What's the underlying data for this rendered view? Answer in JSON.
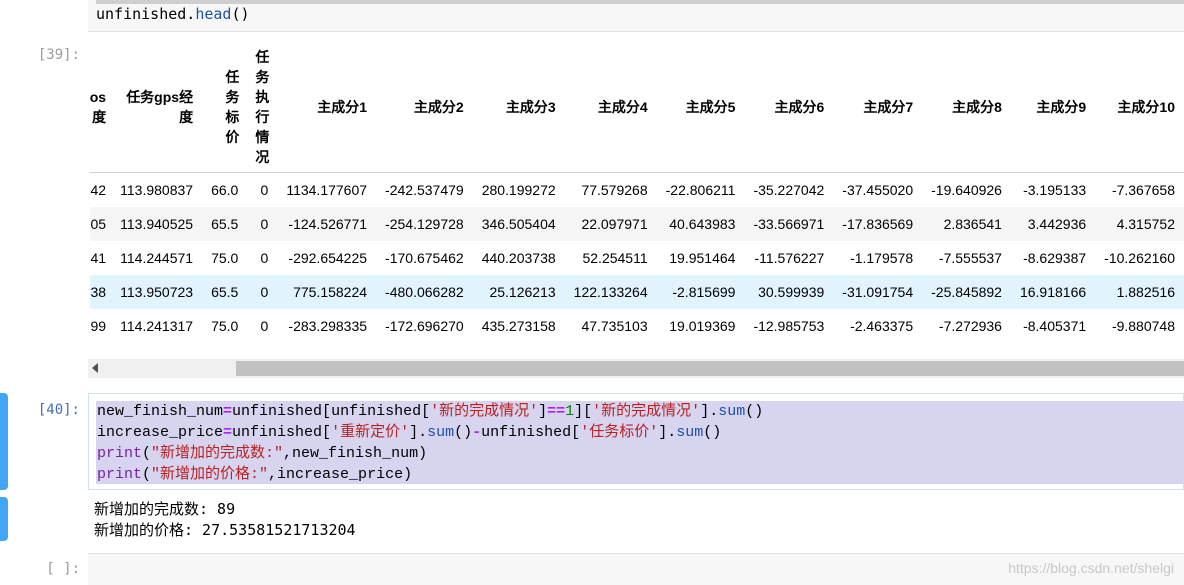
{
  "prev_cell": {
    "code": "unfinished.head()"
  },
  "output_39": {
    "prompt": "[39]:",
    "columns": [
      "os 度",
      "任务gps经度",
      "任务标价",
      "任务执行情况",
      "主成分1",
      "主成分2",
      "主成分3",
      "主成分4",
      "主成分5",
      "主成分6",
      "主成分7",
      "主成分8",
      "主成分9",
      "主成分10"
    ],
    "rows": [
      [
        "42",
        "113.980837",
        "66.0",
        "0",
        "1134.177607",
        "-242.537479",
        "280.199272",
        "77.579268",
        "-22.806211",
        "-35.227042",
        "-37.455020",
        "-19.640926",
        "-3.195133",
        "-7.367658"
      ],
      [
        "05",
        "113.940525",
        "65.5",
        "0",
        "-124.526771",
        "-254.129728",
        "346.505404",
        "22.097971",
        "40.643983",
        "-33.566971",
        "-17.836569",
        "2.836541",
        "3.442936",
        "4.315752"
      ],
      [
        "41",
        "114.244571",
        "75.0",
        "0",
        "-292.654225",
        "-170.675462",
        "440.203738",
        "52.254511",
        "19.951464",
        "-11.576227",
        "-1.179578",
        "-7.555537",
        "-8.629387",
        "-10.262160"
      ],
      [
        "38",
        "113.950723",
        "65.5",
        "0",
        "775.158224",
        "-480.066282",
        "25.126213",
        "122.133264",
        "-2.815699",
        "30.599939",
        "-31.091754",
        "-25.845892",
        "16.918166",
        "1.882516"
      ],
      [
        "99",
        "114.241317",
        "75.0",
        "0",
        "-283.298335",
        "-172.696270",
        "435.273158",
        "47.735103",
        "19.019369",
        "-12.985753",
        "-2.463375",
        "-7.272936",
        "-8.405371",
        "-9.880748"
      ]
    ]
  },
  "cell_40": {
    "prompt": "[40]:",
    "lines": [
      "new_finish_num=unfinished[unfinished['新的完成情况']==1]['新的完成情况'].sum()",
      "increase_price=unfinished['重新定价'].sum()-unfinished['任务标价'].sum()",
      "print(\"新增加的完成数:\",new_finish_num)",
      "print(\"新增加的价格:\",increase_price)"
    ]
  },
  "stdout_40": {
    "line1": "新增加的完成数: 89",
    "line2": "新增加的价格: 27.53581521713204"
  },
  "empty_cell": {
    "prompt": "[ ]:"
  },
  "watermark": "https://blog.csdn.net/shelgi",
  "colors": {
    "selected_bar": "#42a5f5",
    "highlight": "#d7d4f0",
    "prompt_in": "#3f6fb2"
  }
}
